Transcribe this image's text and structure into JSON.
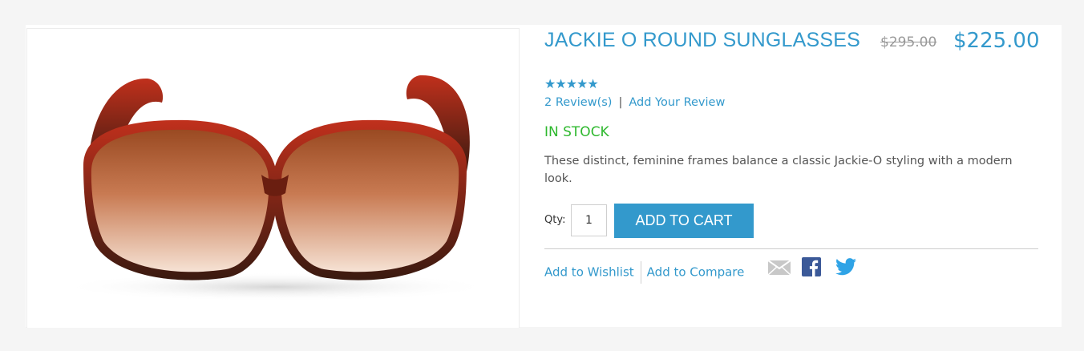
{
  "product": {
    "title": "JACKIE O ROUND SUNGLASSES",
    "old_price": "$295.00",
    "price": "$225.00",
    "rating_stars": "★★★★★",
    "reviews_link": "2 Review(s)",
    "review_separator": "|",
    "add_review_link": "Add Your Review",
    "stock_status": "IN STOCK",
    "description": "These distinct, feminine frames balance a classic Jackie-O styling with a modern look.",
    "qty_label": "Qty:",
    "qty_value": "1",
    "add_to_cart": "ADD TO CART",
    "wishlist_link": "Add to Wishlist",
    "compare_link": "Add to Compare"
  },
  "share": {
    "icons": [
      "email-icon",
      "facebook-icon",
      "twitter-icon"
    ]
  },
  "colors": {
    "accent": "#3399cc",
    "in_stock": "#2eb82e",
    "facebook": "#3b5998",
    "twitter": "#2fa3e6"
  }
}
